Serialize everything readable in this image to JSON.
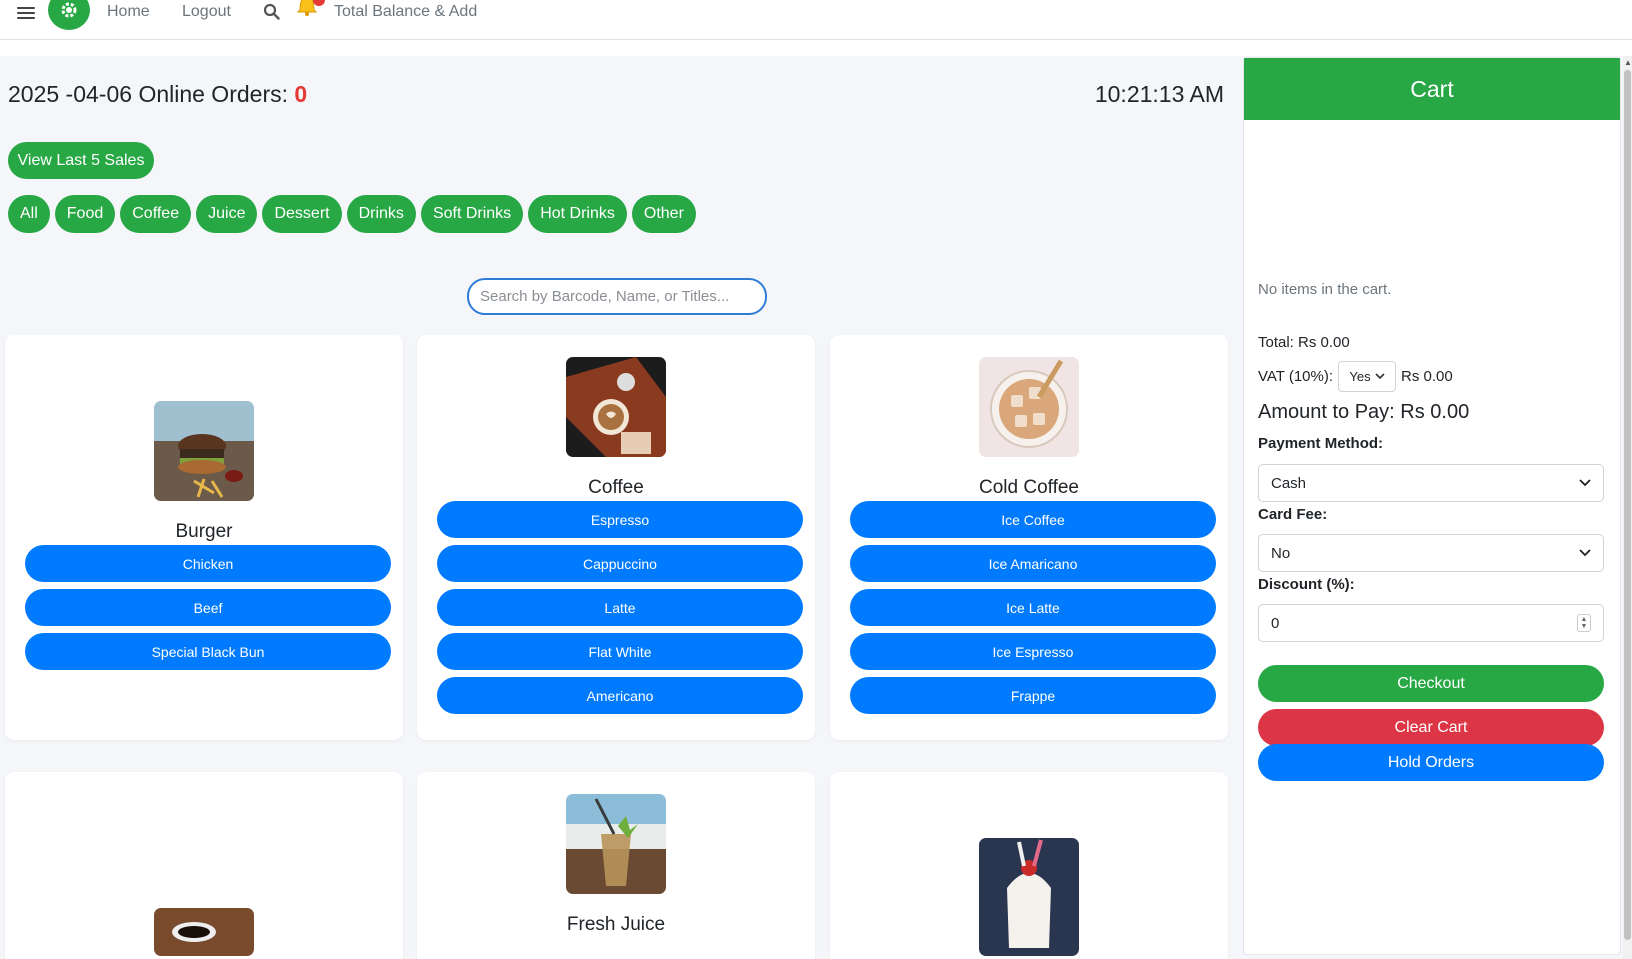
{
  "nav": {
    "home": "Home",
    "logout": "Logout",
    "balance": "Total Balance & Add"
  },
  "header": {
    "date": "2025 -04-06",
    "orders_label": "Online Orders:",
    "orders_count": "0",
    "time": "10:21:13 AM",
    "last_sales_label": "View Last 5 Sales"
  },
  "categories": [
    "All",
    "Food",
    "Coffee",
    "Juice",
    "Dessert",
    "Drinks",
    "Soft Drinks",
    "Hot Drinks",
    "Other"
  ],
  "search": {
    "placeholder": "Search by Barcode, Name, or Titles..."
  },
  "products": [
    {
      "title": "Burger",
      "options": [
        "Chicken",
        "Beef",
        "Special Black Bun"
      ]
    },
    {
      "title": "Coffee",
      "options": [
        "Espresso",
        "Cappuccino",
        "Latte",
        "Flat White",
        "Americano"
      ]
    },
    {
      "title": "Cold Coffee",
      "options": [
        "Ice Coffee",
        "Ice Amaricano",
        "Ice Latte",
        "Ice Espresso",
        "Frappe"
      ]
    },
    {
      "title": "",
      "options": []
    },
    {
      "title": "Fresh Juice",
      "options": []
    },
    {
      "title": "",
      "options": []
    }
  ],
  "cart": {
    "title": "Cart",
    "empty": "No items in the cart.",
    "total": "Total: Rs 0.00",
    "vat_label": "VAT (10%):",
    "vat_value": "Yes",
    "vat_amount": "Rs 0.00",
    "amount_to_pay": "Amount to Pay: Rs 0.00",
    "payment_label": "Payment Method:",
    "payment_value": "Cash",
    "card_fee_label": "Card Fee:",
    "card_fee_value": "No",
    "discount_label": "Discount (%):",
    "discount_value": "0",
    "checkout": "Checkout",
    "clear": "Clear Cart",
    "hold": "Hold Orders"
  },
  "colors": {
    "green": "#28a745",
    "blue": "#007bff",
    "red": "#dc3545",
    "alert": "#e53935"
  }
}
